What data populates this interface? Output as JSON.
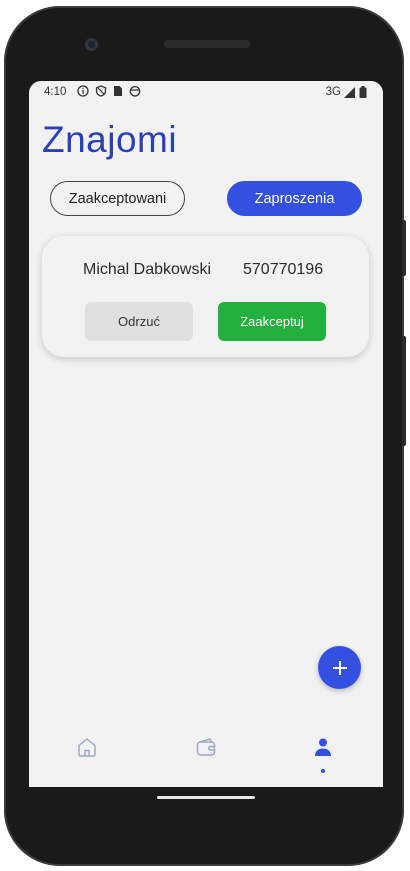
{
  "status_bar": {
    "time": "4:10",
    "network": "3G",
    "left_icons": [
      "info-icon",
      "shield-icon",
      "sim-icon",
      "face-icon"
    ],
    "right_icons": [
      "signal-icon",
      "battery-icon"
    ]
  },
  "page": {
    "title": "Znajomi"
  },
  "tabs": [
    {
      "label": "Zaakceptowani",
      "active": false
    },
    {
      "label": "Zaproszenia",
      "active": true
    }
  ],
  "invitation": {
    "name": "Michal Dabkowski",
    "phone": "570770196",
    "reject_label": "Odrzuć",
    "accept_label": "Zaakceptuj"
  },
  "fab": {
    "icon": "plus-icon"
  },
  "bottom_nav": [
    {
      "icon": "home-icon",
      "active": false
    },
    {
      "icon": "wallet-icon",
      "active": false
    },
    {
      "icon": "person-icon",
      "active": true
    }
  ],
  "colors": {
    "title": "#2b3fb6",
    "primary": "#3450e0",
    "accept": "#22b13f",
    "reject": "#e0e0e0",
    "background": "#f2f2f2",
    "nav_inactive": "#9aa4c8"
  }
}
